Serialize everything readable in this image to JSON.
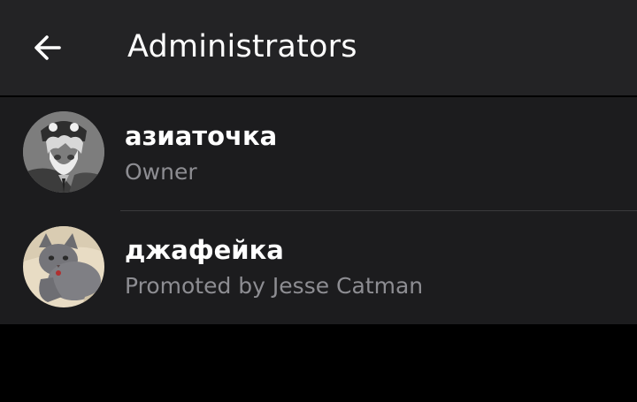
{
  "header": {
    "back_icon": "arrow-left-icon",
    "title": "Administrators"
  },
  "admins": [
    {
      "name": "азиаточка",
      "role": "Owner",
      "avatar": "anime-character-avatar"
    },
    {
      "name": "джафейка",
      "role": "Promoted by Jesse Catman",
      "avatar": "grey-cat-avatar"
    }
  ],
  "colors": {
    "header_bg": "#232325",
    "list_bg": "#1c1c1e",
    "background": "#000000",
    "primary_text": "#ffffff",
    "secondary_text": "#8d8d92",
    "divider": "#3a3a3c"
  }
}
